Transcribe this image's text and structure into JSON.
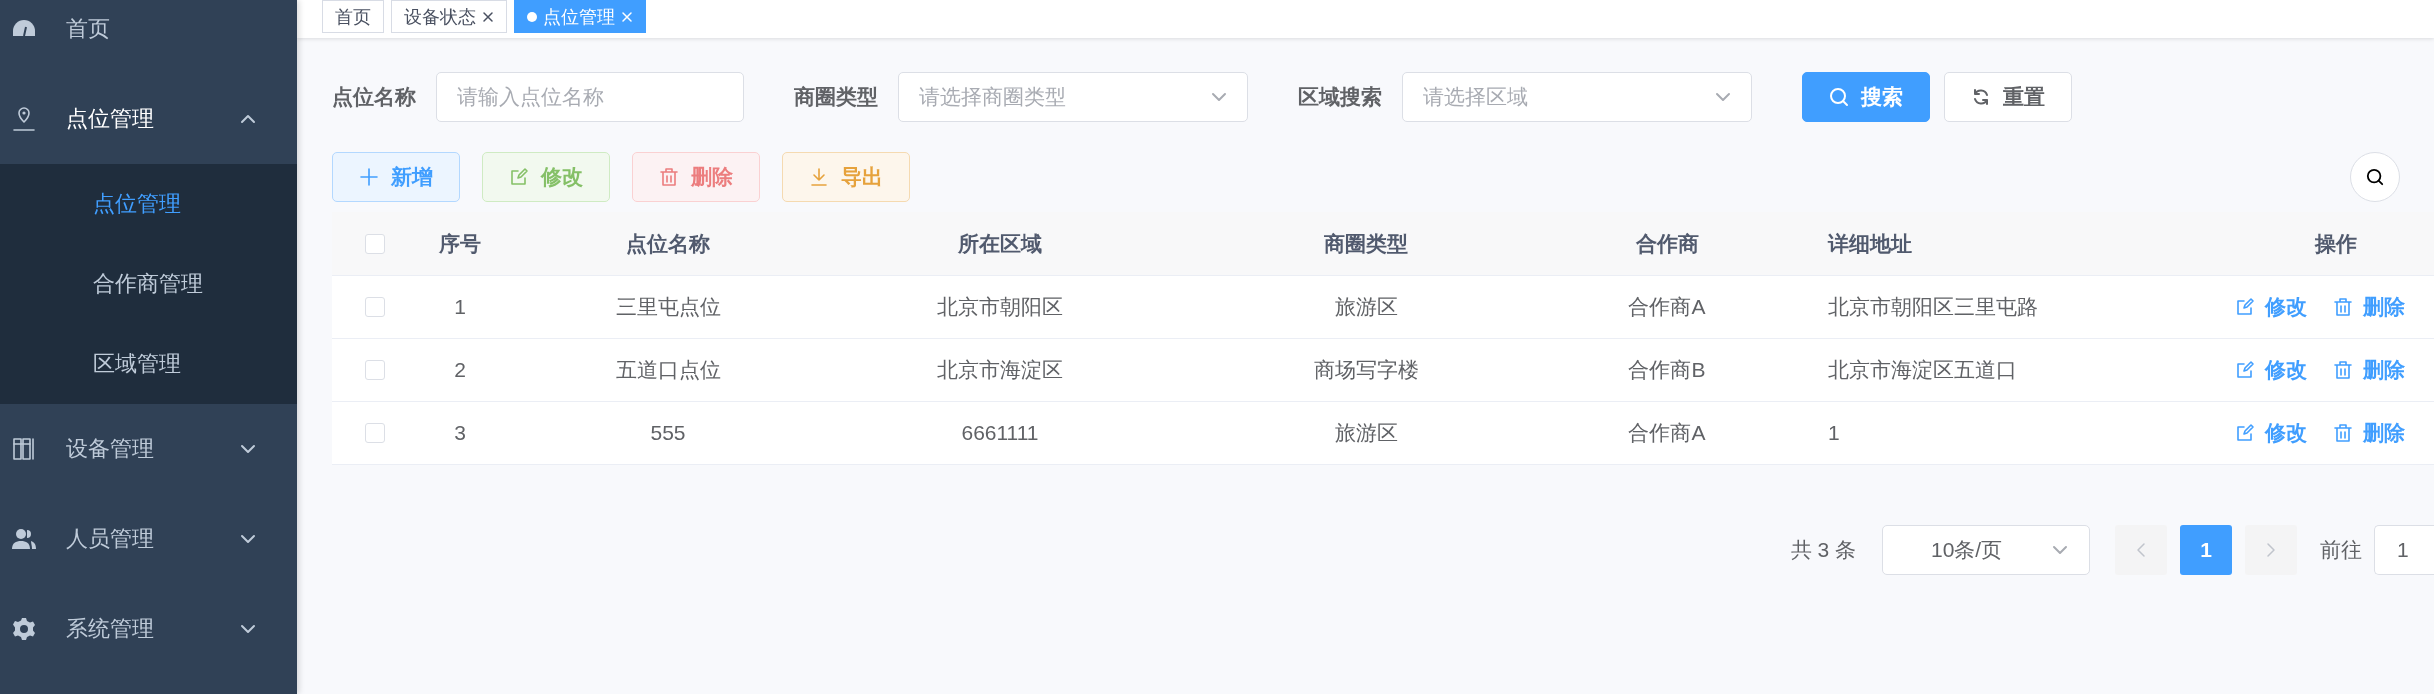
{
  "sidebar": {
    "items": [
      {
        "label": "首页",
        "kind": "link"
      },
      {
        "label": "点位管理",
        "kind": "group",
        "expanded": true,
        "children": [
          {
            "label": "点位管理",
            "selected": true
          },
          {
            "label": "合作商管理",
            "selected": false
          },
          {
            "label": "区域管理",
            "selected": false
          }
        ]
      },
      {
        "label": "设备管理",
        "kind": "group",
        "expanded": false
      },
      {
        "label": "人员管理",
        "kind": "group",
        "expanded": false
      },
      {
        "label": "系统管理",
        "kind": "group",
        "expanded": false
      }
    ]
  },
  "tabs": [
    {
      "label": "首页",
      "selected": false,
      "closable": false
    },
    {
      "label": "设备状态",
      "selected": false,
      "closable": true
    },
    {
      "label": "点位管理",
      "selected": true,
      "closable": true
    }
  ],
  "filters": [
    {
      "label": "点位名称",
      "kind": "input",
      "placeholder": "请输入点位名称"
    },
    {
      "label": "商圈类型",
      "kind": "select",
      "placeholder": "请选择商圈类型"
    },
    {
      "label": "区域搜索",
      "kind": "select",
      "placeholder": "请选择区域"
    }
  ],
  "search_buttons": [
    {
      "label": "搜索",
      "kind": "search"
    },
    {
      "label": "重置",
      "kind": "reset"
    }
  ],
  "toolbar": [
    {
      "label": "新增",
      "kind": "add",
      "disabled": false
    },
    {
      "label": "修改",
      "kind": "edit",
      "disabled": true
    },
    {
      "label": "删除",
      "kind": "delete",
      "disabled": true
    },
    {
      "label": "导出",
      "kind": "export",
      "disabled": false
    }
  ],
  "table": {
    "header_checked": false,
    "columns": [
      "序号",
      "点位名称",
      "所在区域",
      "商圈类型",
      "合作商",
      "详细地址",
      "操作"
    ],
    "rows": [
      {
        "checked": false,
        "cells": [
          "1",
          "三里屯点位",
          "北京市朝阳区",
          "旅游区",
          "合作商A",
          "北京市朝阳区三里屯路"
        ],
        "actions": [
          "修改",
          "删除"
        ]
      },
      {
        "checked": false,
        "cells": [
          "2",
          "五道口点位",
          "北京市海淀区",
          "商场写字楼",
          "合作商B",
          "北京市海淀区五道口"
        ],
        "actions": [
          "修改",
          "删除"
        ]
      },
      {
        "checked": false,
        "cells": [
          "3",
          "555",
          "6661111",
          "旅游区",
          "合作商A",
          "1"
        ],
        "actions": [
          "修改",
          "删除"
        ]
      }
    ]
  },
  "pagination": {
    "total": "共 3 条",
    "page_size": "10条/页",
    "pages": [
      {
        "label": "1",
        "selected": true
      }
    ],
    "goto_label": "前往",
    "goto_value": "1"
  }
}
